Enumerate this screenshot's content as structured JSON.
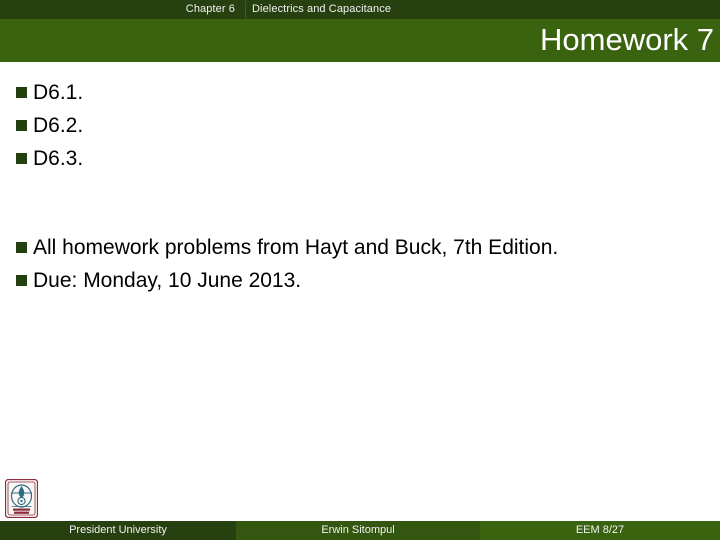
{
  "header": {
    "chapter_label": "Chapter 6",
    "chapter_title": "Dielectrics and Capacitance",
    "slide_title": "Homework 7",
    "topbar_color": "#26400f",
    "band_color": "#3a6310",
    "text_color": "#f2f2f2"
  },
  "body": {
    "bullet_color": "#254010",
    "groups": [
      {
        "name": "problem-list",
        "items": [
          {
            "text": "D6.1."
          },
          {
            "text": "D6.2."
          },
          {
            "text": "D6.3."
          }
        ]
      },
      {
        "name": "notes-list",
        "items": [
          {
            "text": "All homework problems from Hayt and Buck, 7th Edition."
          },
          {
            "text": "Due: Monday, 10 June 2013."
          }
        ]
      }
    ]
  },
  "logo": {
    "icon": "university-crest-logo",
    "border_color": "#8a2a3a",
    "emblem_color": "#2c6d86"
  },
  "footer": {
    "institution": "President University",
    "author": "Erwin Sitompul",
    "page_code": "EEM 8/27",
    "colors": {
      "institution_bg": "#26400f",
      "author_bg": "#335710",
      "page_code_bg": "#3a6310"
    }
  }
}
